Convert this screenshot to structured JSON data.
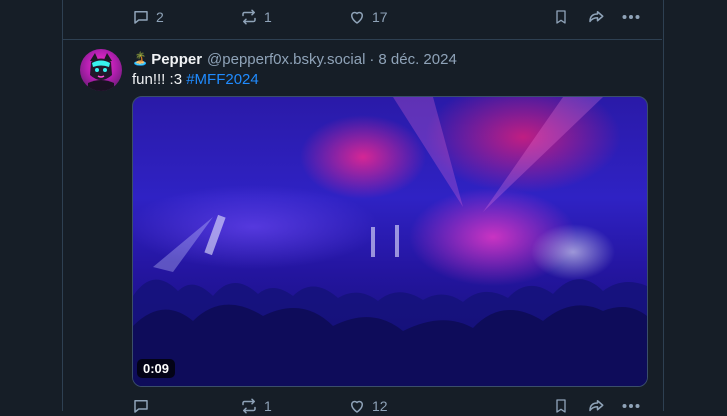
{
  "previous_post": {
    "reply_count": "2",
    "repost_count": "1",
    "like_count": "17"
  },
  "post": {
    "author_emoji": "🏝️",
    "display_name": "Pepper",
    "handle": "@pepperf0x.bsky.social",
    "separator": "·",
    "date": "8 déc. 2024",
    "text": "fun!!! :3 ",
    "hashtag": "#MFF2024",
    "video_duration": "0:09",
    "reply_count": "",
    "repost_count": "1",
    "like_count": "12"
  },
  "colors": {
    "background": "#161e27",
    "border": "#2e4052",
    "muted_text": "#8fa3b8",
    "link": "#208bfe"
  },
  "icons": [
    "reply-icon",
    "repost-icon",
    "like-icon",
    "bookmark-icon",
    "share-icon",
    "more-icon"
  ]
}
